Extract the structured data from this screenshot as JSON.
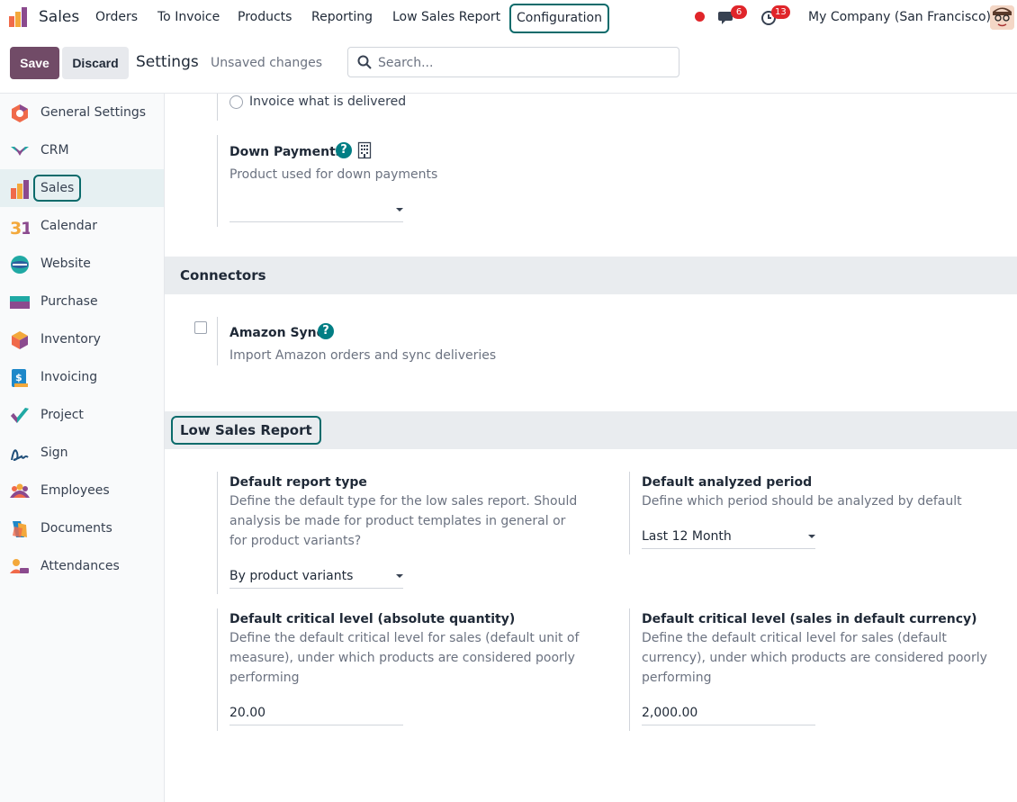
{
  "topnav": {
    "app_name": "Sales",
    "menu": [
      "Orders",
      "To Invoice",
      "Products",
      "Reporting",
      "Low Sales Report",
      "Configuration"
    ],
    "messages_badge": "6",
    "activities_badge": "13",
    "company": "My Company (San Francisco)"
  },
  "controlbar": {
    "save_label": "Save",
    "discard_label": "Discard",
    "title": "Settings",
    "unsaved": "Unsaved changes",
    "search_placeholder": "Search..."
  },
  "sidebar": {
    "items": [
      {
        "label": "General Settings",
        "icon": "general-settings-icon"
      },
      {
        "label": "CRM",
        "icon": "crm-icon"
      },
      {
        "label": "Sales",
        "icon": "sales-icon",
        "active": true
      },
      {
        "label": "Calendar",
        "icon": "calendar-icon"
      },
      {
        "label": "Website",
        "icon": "website-icon"
      },
      {
        "label": "Purchase",
        "icon": "purchase-icon"
      },
      {
        "label": "Inventory",
        "icon": "inventory-icon"
      },
      {
        "label": "Invoicing",
        "icon": "invoicing-icon"
      },
      {
        "label": "Project",
        "icon": "project-icon"
      },
      {
        "label": "Sign",
        "icon": "sign-icon"
      },
      {
        "label": "Employees",
        "icon": "employees-icon"
      },
      {
        "label": "Documents",
        "icon": "documents-icon"
      },
      {
        "label": "Attendances",
        "icon": "attendances-icon"
      }
    ]
  },
  "content": {
    "invoice_option": "Invoice what is delivered",
    "down_payments": {
      "label": "Down Payments",
      "description": "Product used for down payments",
      "value": ""
    },
    "connectors": {
      "title": "Connectors",
      "amazon_label": "Amazon Sync",
      "amazon_desc": "Import Amazon orders and sync deliveries"
    },
    "low_sales": {
      "title": "Low Sales Report",
      "report_type_label": "Default report type",
      "report_type_desc": "Define the default type for the low sales report. Should analysis be made for product templates in general or for product variants?",
      "report_type_value": "By product variants",
      "period_label": "Default analyzed period",
      "period_desc": "Define which period should be analyzed by default",
      "period_value": "Last 12 Month",
      "crit_qty_label": "Default critical level (absolute quantity)",
      "crit_qty_desc": "Define the default critical level for sales (default unit of measure), under which products are considered poorly performing",
      "crit_qty_value": "20.00",
      "crit_sales_label": "Default critical level (sales in default currency)",
      "crit_sales_desc": "Define the default critical level for sales (default currency), under which products are considered poorly performing",
      "crit_sales_value": "2,000.00"
    }
  },
  "colors": {
    "brand": "#714b67",
    "highlight": "#0b6b6b",
    "help": "#017e84",
    "badge": "#e0252a"
  }
}
